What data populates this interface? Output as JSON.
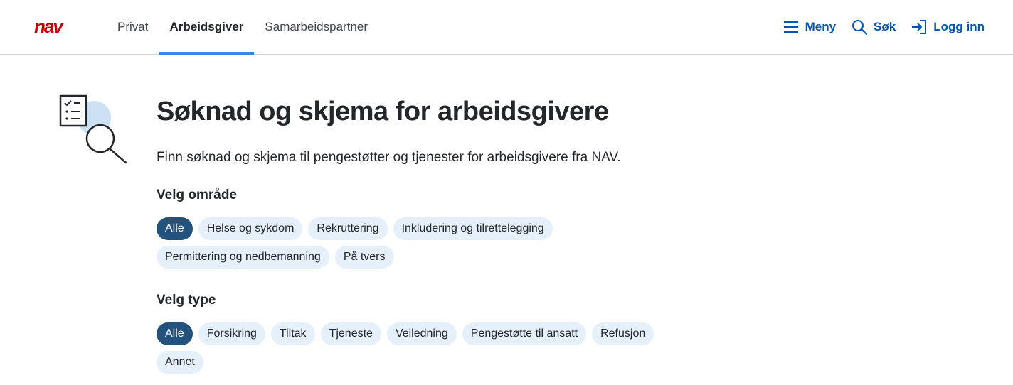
{
  "brand": {
    "name": "nav",
    "color": "#c30000"
  },
  "nav": {
    "tabs": [
      {
        "label": "Privat"
      },
      {
        "label": "Arbeidsgiver",
        "active": true
      },
      {
        "label": "Samarbeidspartner"
      }
    ],
    "actions": {
      "menu": "Meny",
      "search": "Søk",
      "login": "Logg inn"
    }
  },
  "page": {
    "title": "Søknad og skjema for arbeidsgivere",
    "ingress": "Finn søknad og skjema til pengestøtter og tjenester for arbeidsgivere fra NAV.",
    "illustration": "checklist-magnifier-illustration"
  },
  "filters": {
    "area": {
      "heading": "Velg område",
      "selected": "Alle",
      "options": [
        "Alle",
        "Helse og sykdom",
        "Rekruttering",
        "Inkludering og tilrettelegging",
        "Permittering og nedbemanning",
        "På tvers"
      ]
    },
    "type": {
      "heading": "Velg type",
      "selected": "Alle",
      "options": [
        "Alle",
        "Forsikring",
        "Tiltak",
        "Tjeneste",
        "Veiledning",
        "Pengestøtte til ansatt",
        "Refusjon",
        "Annet"
      ]
    }
  },
  "colors": {
    "accent": "#0056b4",
    "active_tab_line": "#3386e0",
    "chip_bg": "#e6f0fb",
    "chip_selected_bg": "#23527c"
  }
}
